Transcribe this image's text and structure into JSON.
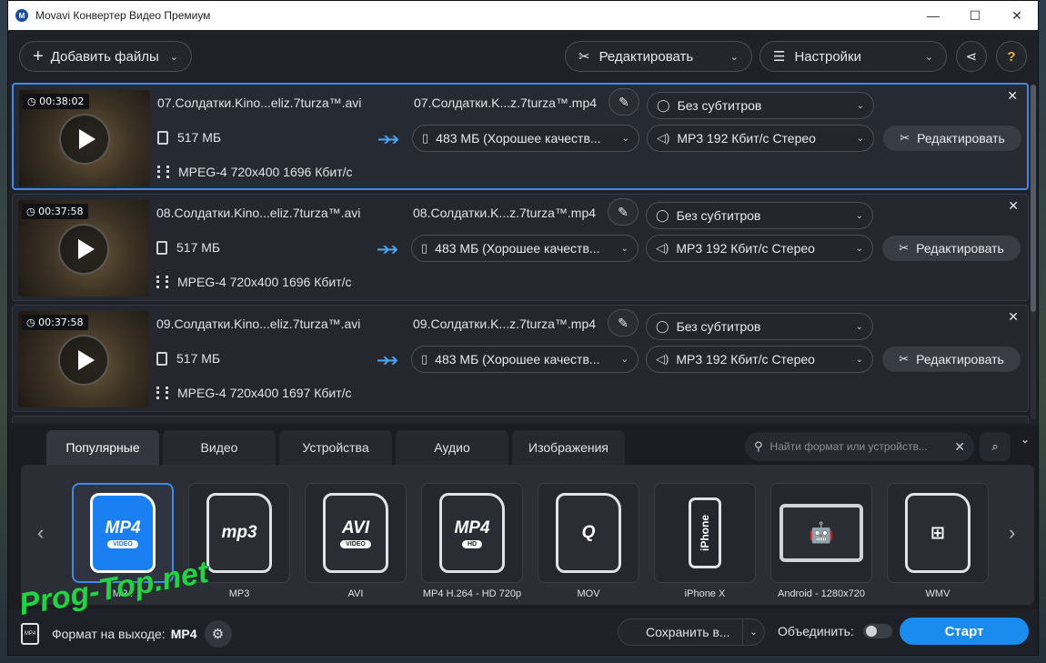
{
  "window": {
    "title": "Movavi Конвертер Видео Премиум",
    "minimize": "—",
    "maximize": "☐",
    "close": "✕"
  },
  "toolbar": {
    "add_files": "Добавить файлы",
    "edit": "Редактировать",
    "settings": "Настройки"
  },
  "files": [
    {
      "duration": "00:38:02",
      "source_name": "07.Солдатки.Kino...eliz.7turza™.avi",
      "source_size": "517 МБ",
      "source_meta": "MPEG-4 720x400 1696 Кбит/с",
      "output_name": "07.Солдатки.K...z.7turza™.mp4",
      "output_size": "483 МБ (Хорошее качеств...",
      "subtitles": "Без субтитров",
      "audio": "MP3 192 Кбит/с Стерео",
      "edit_label": "Редактировать"
    },
    {
      "duration": "00:37:58",
      "source_name": "08.Солдатки.Kino...eliz.7turza™.avi",
      "source_size": "517 МБ",
      "source_meta": "MPEG-4 720x400 1696 Кбит/с",
      "output_name": "08.Солдатки.K...z.7turza™.mp4",
      "output_size": "483 МБ (Хорошее качеств...",
      "subtitles": "Без субтитров",
      "audio": "MP3 192 Кбит/с Стерео",
      "edit_label": "Редактировать"
    },
    {
      "duration": "00:37:58",
      "source_name": "09.Солдатки.Kino...eliz.7turza™.avi",
      "source_size": "517 МБ",
      "source_meta": "MPEG-4 720x400 1697 Кбит/с",
      "output_name": "09.Солдатки.K...z.7turza™.mp4",
      "output_size": "483 МБ (Хорошее качеств...",
      "subtitles": "Без субтитров",
      "audio": "MP3 192 Кбит/с Стерео",
      "edit_label": "Редактировать"
    }
  ],
  "format_tabs": [
    "Популярные",
    "Видео",
    "Устройства",
    "Аудио",
    "Изображения"
  ],
  "format_search": {
    "placeholder": "Найти формат или устройств..."
  },
  "formats": [
    {
      "label": "MP4",
      "icon_text": "MP4",
      "icon_sub": "VIDEO"
    },
    {
      "label": "MP3",
      "icon_text": "mp3",
      "icon_sub": ""
    },
    {
      "label": "AVI",
      "icon_text": "AVI",
      "icon_sub": "VIDEO"
    },
    {
      "label": "MP4 H.264 - HD 720p",
      "icon_text": "MP4",
      "icon_sub": "HD"
    },
    {
      "label": "MOV",
      "icon_text": "Q",
      "icon_sub": ""
    },
    {
      "label": "iPhone X",
      "icon_text": "iPhone",
      "icon_sub": ""
    },
    {
      "label": "Android - 1280x720",
      "icon_text": "🤖",
      "icon_sub": ""
    },
    {
      "label": "WMV",
      "icon_text": "⊞",
      "icon_sub": ""
    }
  ],
  "bottom": {
    "output_format_label": "Формат на выходе:",
    "output_format_value": "MP4",
    "save_to": "Сохранить в...",
    "merge_label": "Объединить:",
    "start": "Старт"
  },
  "watermark": "Prog-Top.net"
}
